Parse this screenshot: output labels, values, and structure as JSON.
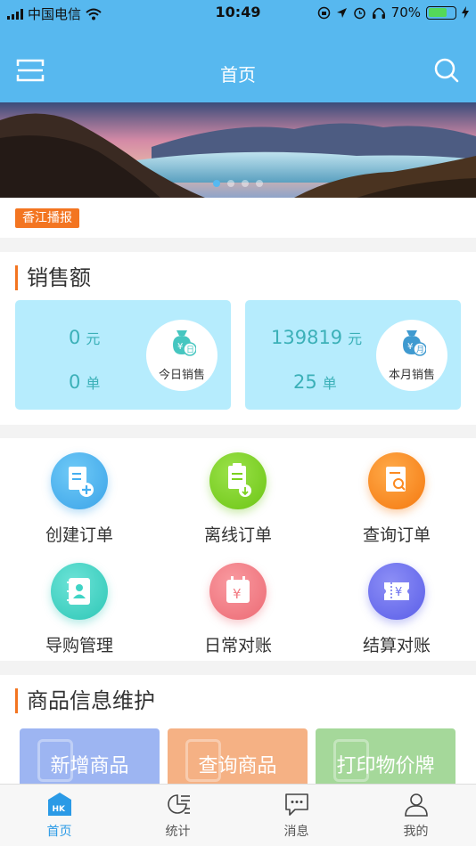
{
  "status_bar": {
    "carrier": "中国电信",
    "time": "10:49",
    "battery": "70%",
    "battery_level": 0.7
  },
  "header": {
    "title": "首页",
    "menu_icon": "menu-icon",
    "search_icon": "search-icon"
  },
  "banner": {
    "slide_count": 4,
    "active_slide": 1
  },
  "news": {
    "tag": "香江播报"
  },
  "sales": {
    "title": "销售额",
    "today": {
      "amount": "0",
      "amount_unit": "元",
      "orders": "0",
      "orders_unit": "单",
      "badge_char": "日",
      "badge_label": "今日销售"
    },
    "month": {
      "amount": "139819",
      "amount_unit": "元",
      "orders": "25",
      "orders_unit": "单",
      "badge_char": "月",
      "badge_label": "本月销售"
    }
  },
  "functions": [
    {
      "label": "创建订单",
      "icon": "create-order-icon",
      "color": "#45aef0"
    },
    {
      "label": "离线订单",
      "icon": "offline-order-icon",
      "color": "#7bd11f"
    },
    {
      "label": "查询订单",
      "icon": "query-order-icon",
      "color": "#fb8a21"
    },
    {
      "label": "导购管理",
      "icon": "guide-manage-icon",
      "color": "#3fd4c5"
    },
    {
      "label": "日常对账",
      "icon": "daily-reconcile-icon",
      "color": "#f27a82"
    },
    {
      "label": "结算对账",
      "icon": "settlement-reconcile-icon",
      "color": "#6b6fee"
    }
  ],
  "goods": {
    "title": "商品信息维护",
    "cards": [
      {
        "label": "新增商品",
        "color": "#9db5f2"
      },
      {
        "label": "查询商品",
        "color": "#f5b184"
      },
      {
        "label": "打印物价牌",
        "color": "#a5d89a"
      }
    ]
  },
  "tabs": [
    {
      "label": "首页",
      "icon": "home-icon",
      "badge": "HK",
      "active": true
    },
    {
      "label": "统计",
      "icon": "stats-icon",
      "active": false
    },
    {
      "label": "消息",
      "icon": "message-icon",
      "active": false
    },
    {
      "label": "我的",
      "icon": "profile-icon",
      "active": false
    }
  ]
}
